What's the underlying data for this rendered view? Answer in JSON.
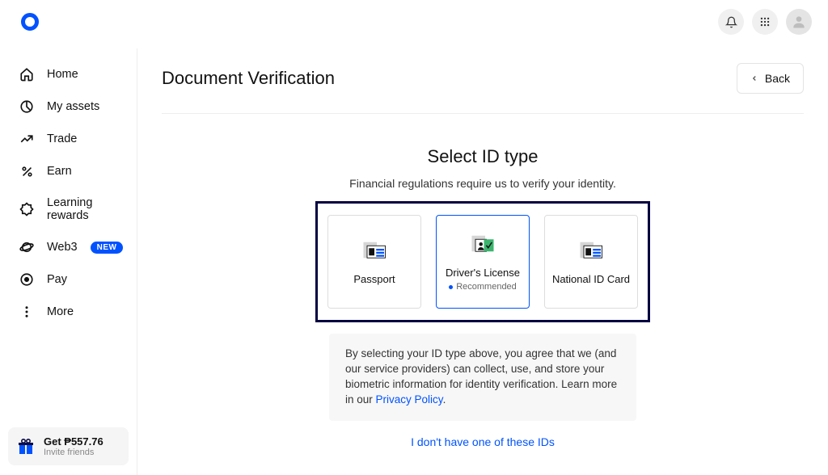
{
  "header": {
    "page_title": "Document Verification",
    "back_label": "Back"
  },
  "sidebar": {
    "items": [
      {
        "label": "Home"
      },
      {
        "label": "My assets"
      },
      {
        "label": "Trade"
      },
      {
        "label": "Earn"
      },
      {
        "label": "Learning rewards"
      },
      {
        "label": "Web3",
        "badge": "NEW"
      },
      {
        "label": "Pay"
      },
      {
        "label": "More"
      }
    ],
    "referral": {
      "title": "Get ₱557.76",
      "subtitle": "Invite friends"
    }
  },
  "verify": {
    "title": "Select ID type",
    "subtitle": "Financial regulations require us to verify your identity.",
    "options": [
      {
        "label": "Passport"
      },
      {
        "label": "Driver's License",
        "recommended": "Recommended"
      },
      {
        "label": "National ID Card"
      }
    ],
    "disclaimer_pre": "By selecting your ID type above, you agree that we (and our service providers) can collect, use, and store your biometric information for identity verification. Learn more in our ",
    "disclaimer_link": "Privacy Policy",
    "disclaimer_post": ".",
    "no_id": "I don't have one of these IDs"
  }
}
